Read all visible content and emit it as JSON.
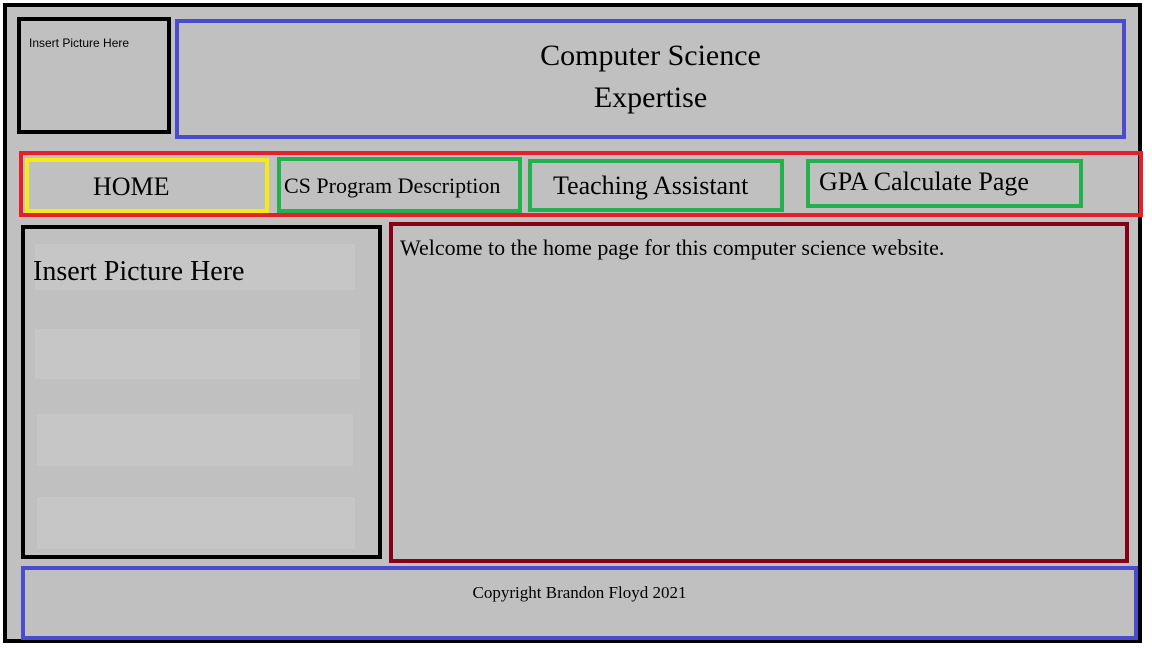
{
  "logo": {
    "placeholder_text": "Insert Picture Here"
  },
  "header": {
    "title_line1": "Computer Science",
    "title_line2": "Expertise"
  },
  "nav": {
    "home": "HOME",
    "cs_program": "CS Program Description",
    "teaching_assistant": "Teaching Assistant",
    "gpa": "GPA Calculate Page"
  },
  "sidebar": {
    "placeholder_text": "Insert Picture Here"
  },
  "main": {
    "welcome_text": "Welcome to the home page for this computer science website."
  },
  "footer": {
    "copyright": "Copyright Brandon Floyd 2021"
  },
  "colors": {
    "background": "#c0c0c0",
    "outline_black": "#000000",
    "outline_blue": "#4b4bd0",
    "outline_red": "#e5202a",
    "outline_yellow": "#f4ea1a",
    "outline_green": "#22b14c",
    "outline_maroon": "#880015"
  }
}
